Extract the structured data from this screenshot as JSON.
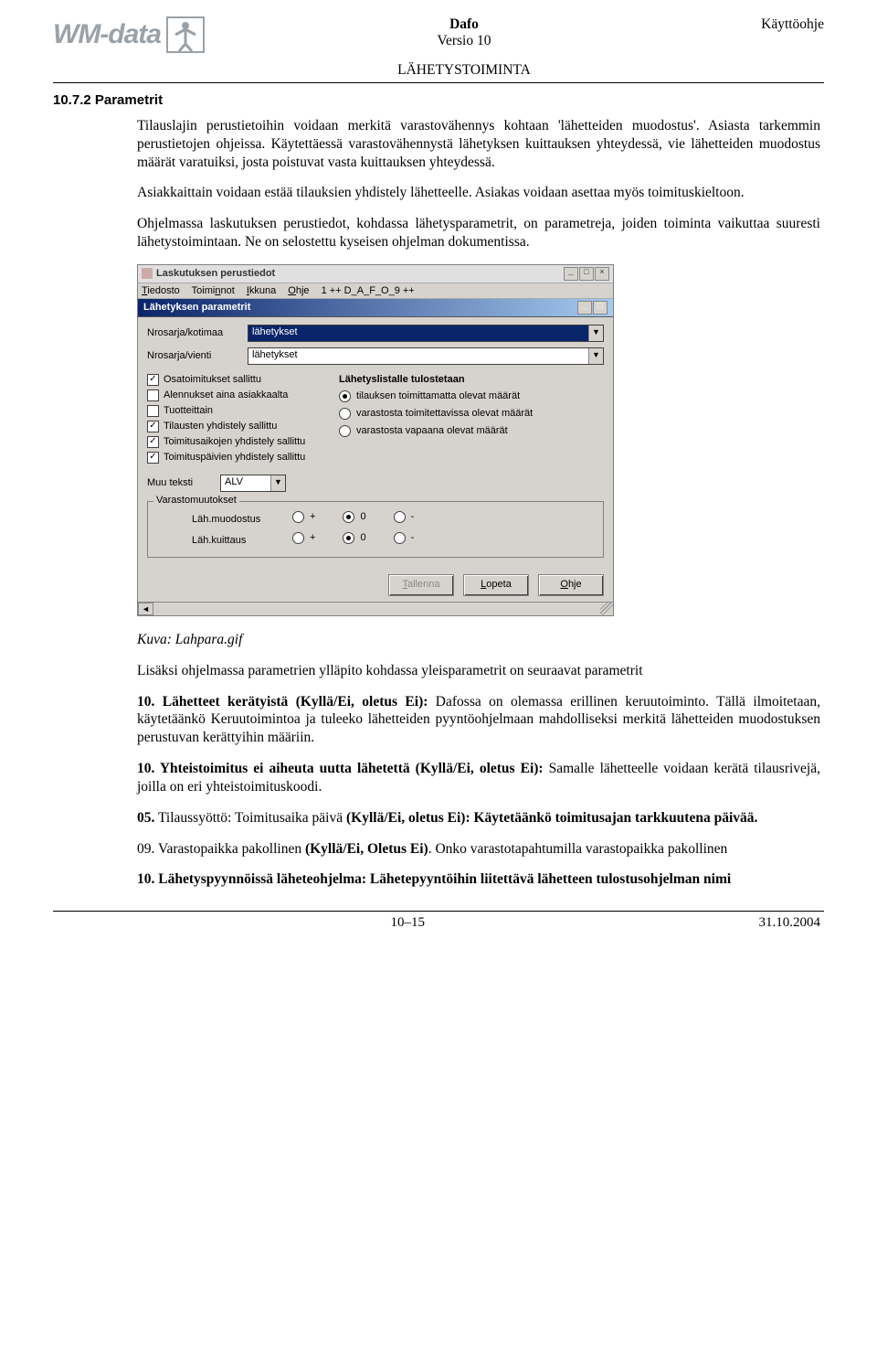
{
  "header": {
    "logo_text": "WM-data",
    "title": "Dafo",
    "version": "Versio 10",
    "doc_header": "LÄHETYSTOIMINTA",
    "right": "Käyttöohje"
  },
  "section": {
    "number_title": "10.7.2 Parametrit"
  },
  "paragraphs": {
    "p1": "Tilauslajin perustietoihin voidaan merkitä varastovähennys kohtaan 'lähetteiden muodostus'. Asiasta tarkemmin perustietojen ohjeissa. Käytettäessä varastovähennystä lähetyksen kuittauksen yhteydessä, vie lähetteiden muodostus määrät varatuiksi, josta poistuvat vasta kuittauksen yhteydessä.",
    "p2": "Asiakkaittain voidaan estää tilauksien yhdistely lähetteelle. Asiakas voidaan asettaa myös toimituskieltoon.",
    "p3": "Ohjelmassa laskutuksen perustiedot, kohdassa lähetysparametrit, on parametreja, joiden toiminta vaikuttaa suuresti lähetystoimintaan. Ne on selostettu kyseisen ohjelman dokumentissa.",
    "caption": "Kuva: Lahpara.gif",
    "p4": "Lisäksi ohjelmassa parametrien ylläpito kohdassa yleisparametrit on seuraavat parametrit",
    "p5a": "10. Lähetteet kerätyistä (Kyllä/Ei, oletus Ei):",
    "p5b": " Dafossa on olemassa erillinen keruutoiminto. Tällä ilmoitetaan, käytetäänkö Keruutoimintoa ja tuleeko lähetteiden pyyntöohjelmaan mahdolliseksi merkitä lähetteiden muodostuksen perustuvan kerättyihin määriin.",
    "p6a": "10. Yhteistoimitus ei aiheuta uutta lähetettä (Kyllä/Ei, oletus Ei):",
    "p6b": " Samalle lähetteelle voidaan kerätä tilausrivejä, joilla on eri yhteistoimituskoodi.",
    "p7a": "05.",
    "p7b": " Tilaussyöttö: Toimitusaika päivä ",
    "p7c": "(Kyllä/Ei, oletus Ei): Käytetäänkö toimitusajan tarkkuutena päivää.",
    "p8a": "09. Varastopaikka pakollinen ",
    "p8b": "(Kyllä/Ei, Oletus Ei)",
    "p8c": ". Onko varastotapahtumilla varastopaikka pakollinen",
    "p9a": "10. Lähetyspyynnöissä läheteohjelma: Lähetepyyntöihin liitettävä lähetteen tulostusohjelman nimi"
  },
  "screenshot": {
    "outer_title": "Laskutuksen perustiedot",
    "menu": {
      "m1": "Tiedosto",
      "m2": "Toiminnot",
      "m3": "Ikkuna",
      "m4": "Ohje",
      "m5": "1 ++ D_A_F_O_9 ++"
    },
    "inner_title": "Lähetyksen parametrit",
    "row1_label": "Nrosarja/kotimaa",
    "row1_value": "lähetykset",
    "row2_label": "Nrosarja/vienti",
    "row2_value": "lähetykset",
    "checks": {
      "c1": "Osatoimitukset sallittu",
      "c2": "Alennukset aina asiakkaalta",
      "c3": "Tuotteittain",
      "c4": "Tilausten yhdistely sallittu",
      "c5": "Toimitusaikojen yhdistely sallittu",
      "c6": "Toimituspäivien yhdistely sallittu"
    },
    "group_title": "Lähetyslistalle tulostetaan",
    "radios": {
      "r1": "tilauksen toimittamatta olevat määrät",
      "r2": "varastosta toimitettavissa olevat määrät",
      "r3": "varastosta vapaana olevat määrät"
    },
    "muu_label": "Muu teksti",
    "muu_value": "ALV",
    "fieldset_legend": "Varastomuutokset",
    "fs_row1": "Läh.muodostus",
    "fs_row2": "Läh.kuittaus",
    "opt_plus": "+",
    "opt_zero": "0",
    "opt_minus": "-",
    "btn_save": "Tallenna",
    "btn_quit": "Lopeta",
    "btn_help": "Ohje"
  },
  "footer": {
    "page": "10–15",
    "date": "31.10.2004"
  }
}
